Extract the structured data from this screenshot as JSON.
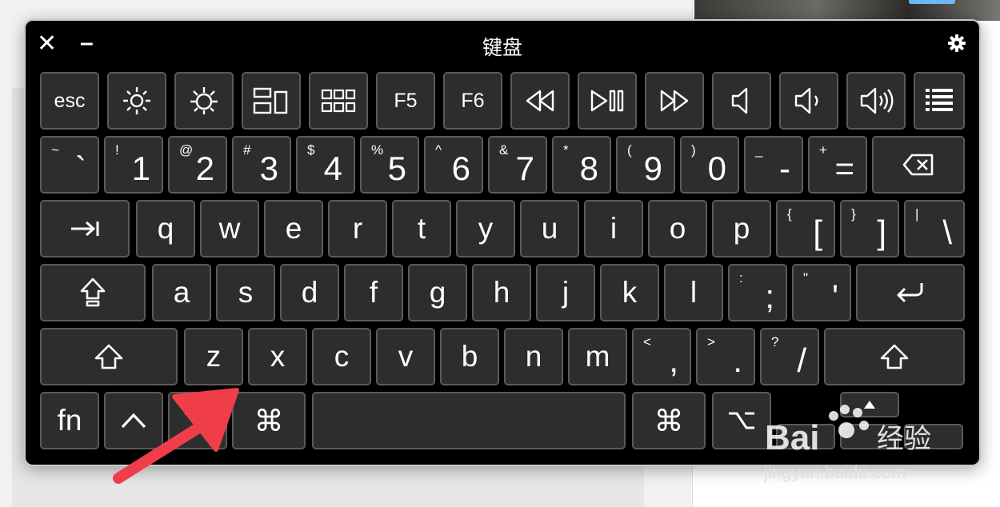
{
  "window": {
    "title": "键盘",
    "close_label": "✕",
    "minimize_label": "–"
  },
  "fn_row": {
    "esc": "esc",
    "f5": "F5",
    "f6": "F6"
  },
  "number_row": [
    {
      "sec": "~",
      "pri": "`"
    },
    {
      "sec": "!",
      "pri": "1"
    },
    {
      "sec": "@",
      "pri": "2"
    },
    {
      "sec": "#",
      "pri": "3"
    },
    {
      "sec": "$",
      "pri": "4"
    },
    {
      "sec": "%",
      "pri": "5"
    },
    {
      "sec": "^",
      "pri": "6"
    },
    {
      "sec": "&",
      "pri": "7"
    },
    {
      "sec": "*",
      "pri": "8"
    },
    {
      "sec": "(",
      "pri": "9"
    },
    {
      "sec": ")",
      "pri": "0"
    },
    {
      "sec": "_",
      "pri": "-"
    },
    {
      "sec": "+",
      "pri": "="
    }
  ],
  "qwerty_row": [
    "q",
    "w",
    "e",
    "r",
    "t",
    "y",
    "u",
    "i",
    "o",
    "p"
  ],
  "qwerty_punct": [
    {
      "sec": "{",
      "pri": "["
    },
    {
      "sec": "}",
      "pri": "]"
    },
    {
      "sec": "|",
      "pri": "\\"
    }
  ],
  "home_row": [
    "a",
    "s",
    "d",
    "f",
    "g",
    "h",
    "j",
    "k",
    "l"
  ],
  "home_punct": [
    {
      "sec": ":",
      "pri": ";"
    },
    {
      "sec": "\"",
      "pri": "'"
    }
  ],
  "bottom_row": [
    "z",
    "x",
    "c",
    "v",
    "b",
    "n",
    "m"
  ],
  "bottom_punct": [
    {
      "sec": "<",
      "pri": ","
    },
    {
      "sec": ">",
      "pri": "."
    },
    {
      "sec": "?",
      "pri": "/"
    }
  ],
  "modifier_row": {
    "fn": "fn",
    "command": "⌘",
    "option": "⌥",
    "control": "^"
  },
  "watermark": {
    "brand": "Bai 经验",
    "url": "jingyan.baidu.com"
  },
  "colors": {
    "key_bg": "#2d2d2d",
    "key_border": "#5a5a5a",
    "window_bg": "#000000",
    "arrow": "#ef3e4a"
  }
}
